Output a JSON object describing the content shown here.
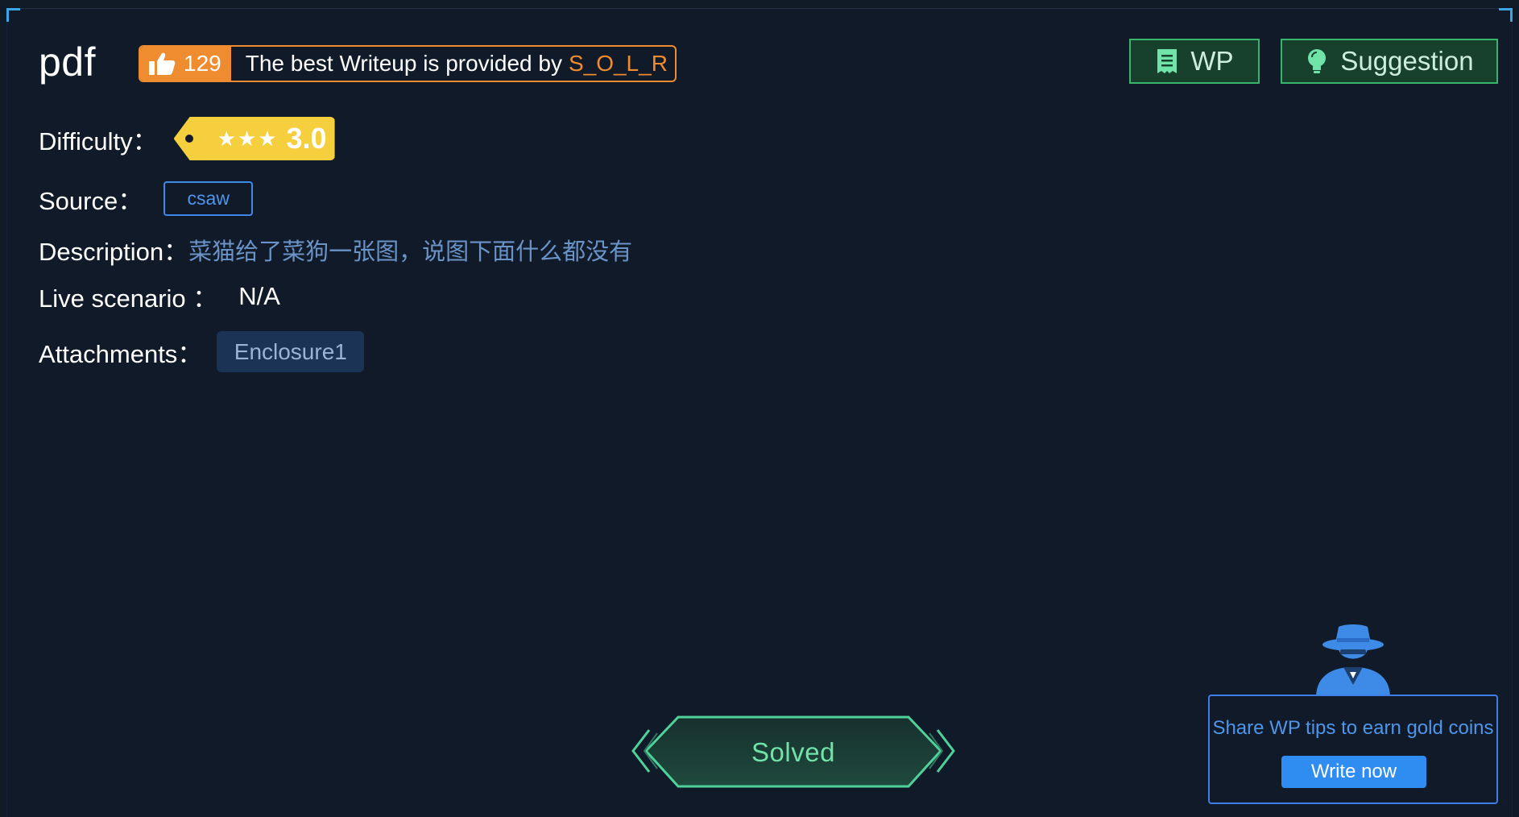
{
  "challenge": {
    "title": "pdf"
  },
  "writeup_banner": {
    "likes": "129",
    "text": "The best Writeup is provided by",
    "author": "S_O_L_R"
  },
  "toolbar": {
    "wp_label": "WP",
    "suggestion_label": "Suggestion"
  },
  "fields": {
    "difficulty_label": "Difficulty：",
    "difficulty_stars": 3,
    "difficulty_score": "3.0",
    "source_label": "Source：",
    "source_value": "csaw",
    "description_label": "Description：",
    "description_value": "菜猫给了菜狗一张图，说图下面什么都没有",
    "live_label": "Live scenario ：",
    "live_value": "N/A",
    "attachments_label": "Attachments：",
    "attachment_name": "Enclosure1"
  },
  "status": {
    "solved_label": "Solved"
  },
  "wp_promo": {
    "tip": "Share WP tips to earn gold coins",
    "button": "Write now"
  },
  "colors": {
    "background": "#101926",
    "accent_orange": "#f08c30",
    "accent_green": "#38b56a",
    "accent_blue": "#3d8be6",
    "difficulty_yellow": "#f6cf3e",
    "solved_text": "#6fe3a8"
  },
  "icons": {
    "likes": "thumbs-up-icon",
    "wp": "document-icon",
    "suggestion": "lightbulb-icon",
    "promo": "spy-icon"
  }
}
